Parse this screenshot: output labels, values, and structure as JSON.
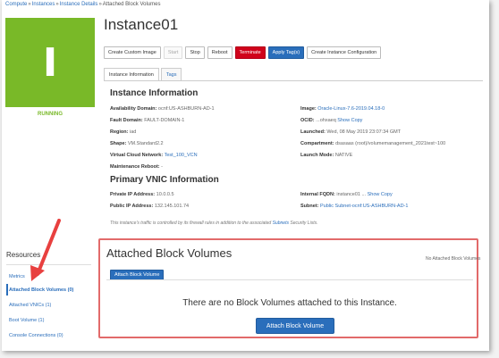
{
  "breadcrumb": {
    "items": [
      "Compute",
      "Instances",
      "Instance Details"
    ],
    "separator": "»",
    "current": "Attached Block Volumes"
  },
  "instance": {
    "letter": "I",
    "status": "RUNNING",
    "name": "Instance01"
  },
  "actions": {
    "create_custom_image": "Create Custom Image",
    "start": "Start",
    "stop": "Stop",
    "reboot": "Reboot",
    "terminate": "Terminate",
    "apply_tags": "Apply Tag(s)",
    "create_instance_config": "Create Instance Configuration"
  },
  "tabs": [
    "Instance Information",
    "Tags"
  ],
  "instance_info": {
    "heading": "Instance Information",
    "availability_domain": {
      "label": "Availability Domain:",
      "value": "ocnf:US-ASHBURN-AD-1"
    },
    "fault_domain": {
      "label": "Fault Domain:",
      "value": "FAULT-DOMAIN-1"
    },
    "region": {
      "label": "Region:",
      "value": "iad"
    },
    "shape": {
      "label": "Shape:",
      "value": "VM.Standard2.2"
    },
    "vcn": {
      "label": "Virtual Cloud Network:",
      "value": "Test_100_VCN"
    },
    "maintenance_reboot": {
      "label": "Maintenance Reboot:",
      "value": "-"
    },
    "image": {
      "label": "Image:",
      "value": "Oracle-Linux-7.6-2019.04.18-0"
    },
    "ocid": {
      "label": "OCID:",
      "value": "...ohxaeq",
      "show": "Show",
      "copy": "Copy"
    },
    "launched": {
      "label": "Launched:",
      "value": "Wed, 08 May 2019 23:07:34 GMT"
    },
    "compartment": {
      "label": "Compartment:",
      "value": "dsasaas (root)/volumemanagement_2021test~100"
    },
    "launch_mode": {
      "label": "Launch Mode:",
      "value": "NATIVE"
    }
  },
  "vnic_info": {
    "heading": "Primary VNIC Information",
    "private_ip": {
      "label": "Private IP Address:",
      "value": "10.0.0.5"
    },
    "public_ip": {
      "label": "Public IP Address:",
      "value": "132.145.101.74"
    },
    "internal_fqdn": {
      "label": "Internal FQDN:",
      "value": "instance01 ...",
      "show": "Show",
      "copy": "Copy"
    },
    "subnet": {
      "label": "Subnet:",
      "value": "Public Subnet-ocnf:US-ASHBURN-AD-1"
    }
  },
  "note": {
    "text": "This instance's traffic is controlled by its firewall rules in addition to the associated",
    "link": "Subnets",
    "suffix": "Security Lists."
  },
  "resources": {
    "title": "Resources",
    "items": [
      "Metrics",
      "Attached Block Volumes (0)",
      "Attached VNICs (1)",
      "Boot Volume (1)",
      "Console Connections (0)"
    ]
  },
  "block_volumes": {
    "title": "Attached Block Volumes",
    "count_label": "No Attached Block Volumes",
    "small_button": "Attach Block Volume",
    "empty_message": "There are no Block Volumes attached to this Instance.",
    "button": "Attach Block Volume"
  },
  "colors": {
    "accent": "#2a6ebb",
    "running": "#79b928",
    "danger": "#d0021b",
    "highlight": "#e26a6a",
    "arrow": "#e8403f"
  }
}
